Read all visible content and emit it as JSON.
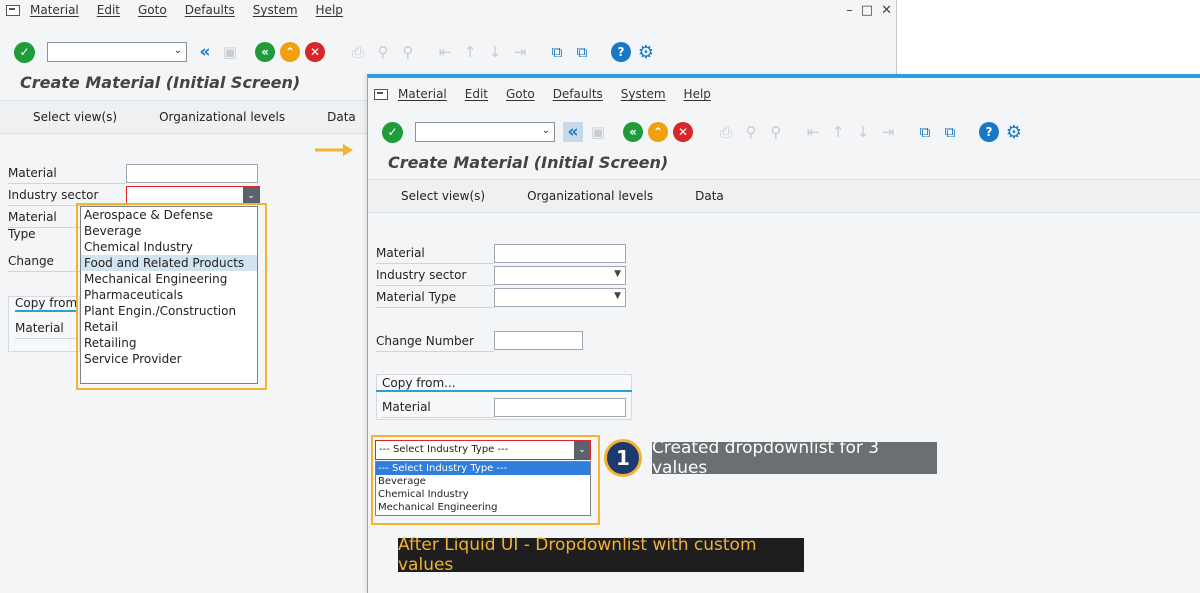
{
  "menu": {
    "items": [
      "Material",
      "Edit",
      "Goto",
      "Defaults",
      "System",
      "Help"
    ]
  },
  "window_controls": {
    "minimize": "–",
    "maximize": "□",
    "close": "✕"
  },
  "toolbar": {
    "icons": [
      "check-icon",
      "command-field",
      "back-double-chevron-icon",
      "save-icon",
      "back-icon",
      "exit-icon",
      "cancel-icon",
      "print-icon",
      "find-icon",
      "first-page-icon",
      "prev-page-icon",
      "next-page-icon",
      "last-page-icon",
      "new-session-icon",
      "shortcut-icon",
      "help-icon",
      "settings-gear-icon"
    ]
  },
  "page": {
    "title": "Create Material (Initial Screen)",
    "tabs": [
      "Select view(s)",
      "Organizational levels",
      "Data"
    ]
  },
  "left_window": {
    "fields": {
      "material": "Material",
      "industry_sector": "Industry sector",
      "material_type": "Material Type",
      "change_number": "Change Numb"
    },
    "copy_from": {
      "title": "Copy from...",
      "material": "Material"
    },
    "industry_sector_list": {
      "options": [
        "Aerospace & Defense",
        "Beverage",
        "Chemical Industry",
        "Food and Related Products",
        "Mechanical Engineering",
        "Pharmaceuticals",
        "Plant Engin./Construction",
        "Retail",
        "Retailing",
        "Service Provider"
      ],
      "highlighted": "Food and Related Products"
    }
  },
  "right_window": {
    "fields": {
      "material": "Material",
      "industry_sector": "Industry sector",
      "material_type": "Material Type",
      "change_number": "Change Number"
    },
    "copy_from": {
      "title": "Copy from...",
      "material": "Material"
    },
    "custom_dropdown": {
      "selected": "--- Select Industry Type ---",
      "options": [
        "--- Select Industry Type ---",
        "Beverage",
        "Chemical Industry",
        "Mechanical Engineering"
      ]
    }
  },
  "annotations": {
    "badge_number": "1",
    "note1": "Created dropdownlist for 3 values",
    "note2": "After Liquid UI - Dropdownlist with custom values"
  },
  "colors": {
    "accent_blue": "#2ba0d8",
    "highlight_orange": "#f2b233",
    "badge_navy": "#1d3a6e",
    "selected_option": "#2f7ddc"
  }
}
